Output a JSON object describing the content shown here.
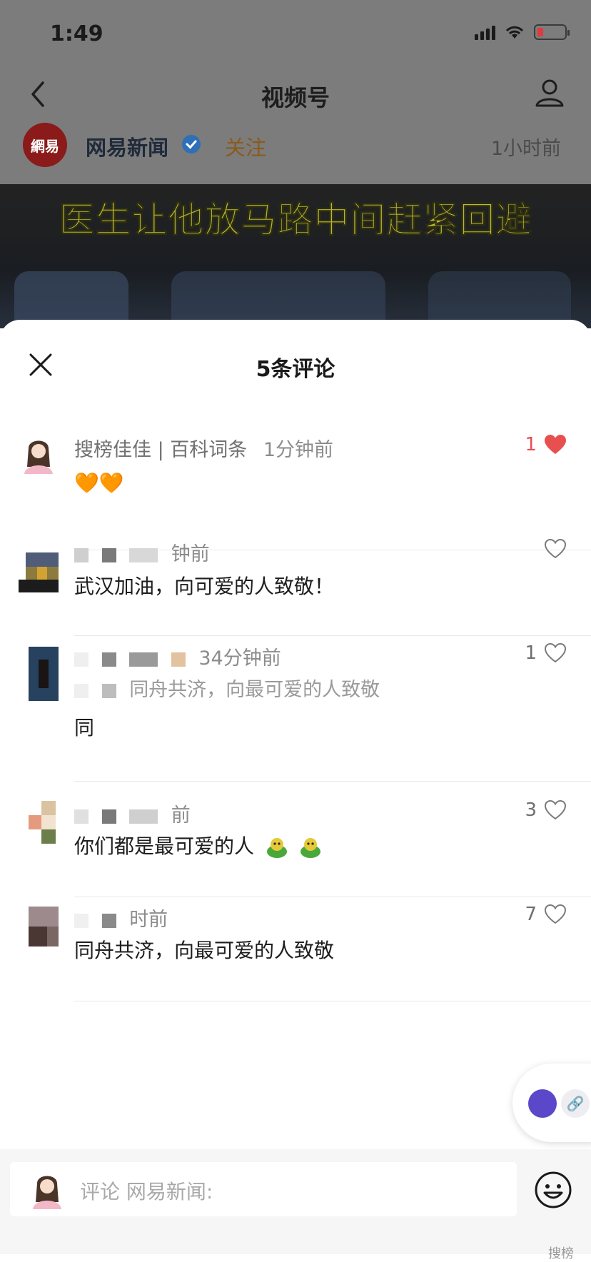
{
  "status_bar": {
    "time": "1:49"
  },
  "nav": {
    "title": "视频号"
  },
  "author": {
    "logo_text": "網易",
    "name": "网易新闻",
    "follow": "关注",
    "time_ago": "1小时前"
  },
  "video": {
    "caption": "医生让他放马路中间赶紧回避"
  },
  "sheet": {
    "title": "5条评论",
    "comments": [
      {
        "name": "搜榜佳佳 | 百科词条",
        "time": "1分钟前",
        "text": "🧡🧡",
        "likes": "1",
        "liked": true
      },
      {
        "name": "",
        "time": "钟前",
        "text": "武汉加油，向可爱的人致敬！",
        "likes": "",
        "liked": false
      },
      {
        "name": "",
        "time": "34分钟前",
        "quote": "同舟共济，向最可爱的人致敬",
        "text": "同",
        "likes": "1",
        "liked": false
      },
      {
        "name": "",
        "time": "前",
        "text": "你们都是最可爱的人",
        "likes": "3",
        "liked": false
      },
      {
        "name": "",
        "time": "时前",
        "text": "同舟共济，向最可爱的人致敬",
        "likes": "7",
        "liked": false
      }
    ]
  },
  "input": {
    "placeholder": "评论 网易新闻:"
  },
  "watermark": "搜榜",
  "colors": {
    "accent_red": "#e8504f",
    "follow": "#8a5a1c",
    "sheet_bg": "#ffffff"
  }
}
